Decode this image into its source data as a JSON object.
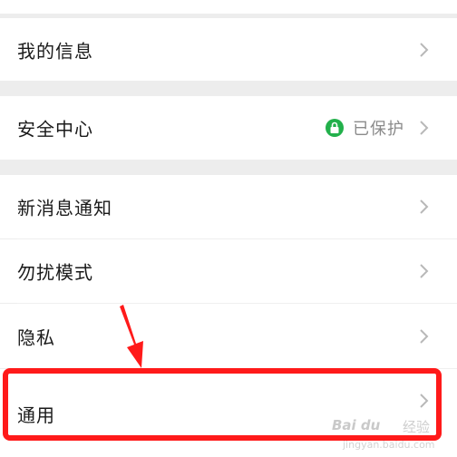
{
  "settings": {
    "my_info": "我的信息",
    "security_center": "安全中心",
    "security_status": "已保护",
    "new_message_notify": "新消息通知",
    "do_not_disturb": "勿扰模式",
    "privacy": "隐私",
    "general": "通用"
  },
  "colors": {
    "highlight": "#ff1a1a",
    "status_ok": "#22b04b"
  },
  "watermark": {
    "brand": "Bai du",
    "brand_cn": "经验",
    "url": "jingyan.baidu.com"
  }
}
